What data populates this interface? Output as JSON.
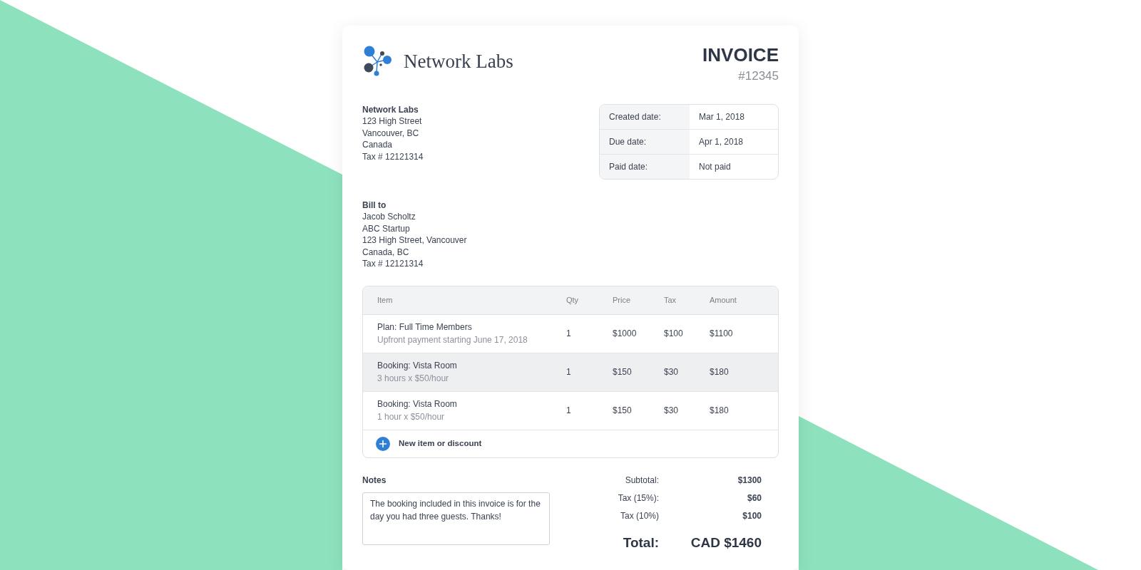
{
  "brand": {
    "name": "Network Labs"
  },
  "invoice": {
    "title": "INVOICE",
    "number": "#12345"
  },
  "from": {
    "heading": "Network Labs",
    "lines": [
      "123 High Street",
      "Vancouver, BC",
      "Canada",
      "Tax # 12121314"
    ]
  },
  "dates": [
    {
      "label": "Created date:",
      "value": "Mar 1, 2018"
    },
    {
      "label": "Due date:",
      "value": "Apr 1, 2018"
    },
    {
      "label": "Paid date:",
      "value": "Not paid"
    }
  ],
  "bill_to": {
    "heading": "Bill to",
    "lines": [
      "Jacob Scholtz",
      "ABC Startup",
      "123 High Street, Vancouver",
      "Canada, BC",
      "Tax # 12121314"
    ]
  },
  "table": {
    "columns": [
      "Item",
      "Qty",
      "Price",
      "Tax",
      "Amount"
    ],
    "rows": [
      {
        "item": "Plan: Full Time Members",
        "detail": "Upfront payment starting June 17, 2018",
        "qty": "1",
        "price": "$1000",
        "tax": "$100",
        "amount": "$1100",
        "selected": false
      },
      {
        "item": "Booking: Vista Room",
        "detail": "3 hours x $50/hour",
        "qty": "1",
        "price": "$150",
        "tax": "$30",
        "amount": "$180",
        "selected": true
      },
      {
        "item": "Booking: Vista Room",
        "detail": "1 hour x $50/hour",
        "qty": "1",
        "price": "$150",
        "tax": "$30",
        "amount": "$180",
        "selected": false
      }
    ],
    "add_button": "New item or discount"
  },
  "notes": {
    "label": "Notes",
    "value": "The booking included in this invoice is for the day you had three guests. Thanks!"
  },
  "totals": [
    {
      "label": "Subtotal:",
      "value": "$1300"
    },
    {
      "label": "Tax (15%):",
      "value": "$60"
    },
    {
      "label": "Tax (10%)",
      "value": "$100"
    }
  ],
  "total": {
    "label": "Total:",
    "value": "CAD $1460"
  }
}
